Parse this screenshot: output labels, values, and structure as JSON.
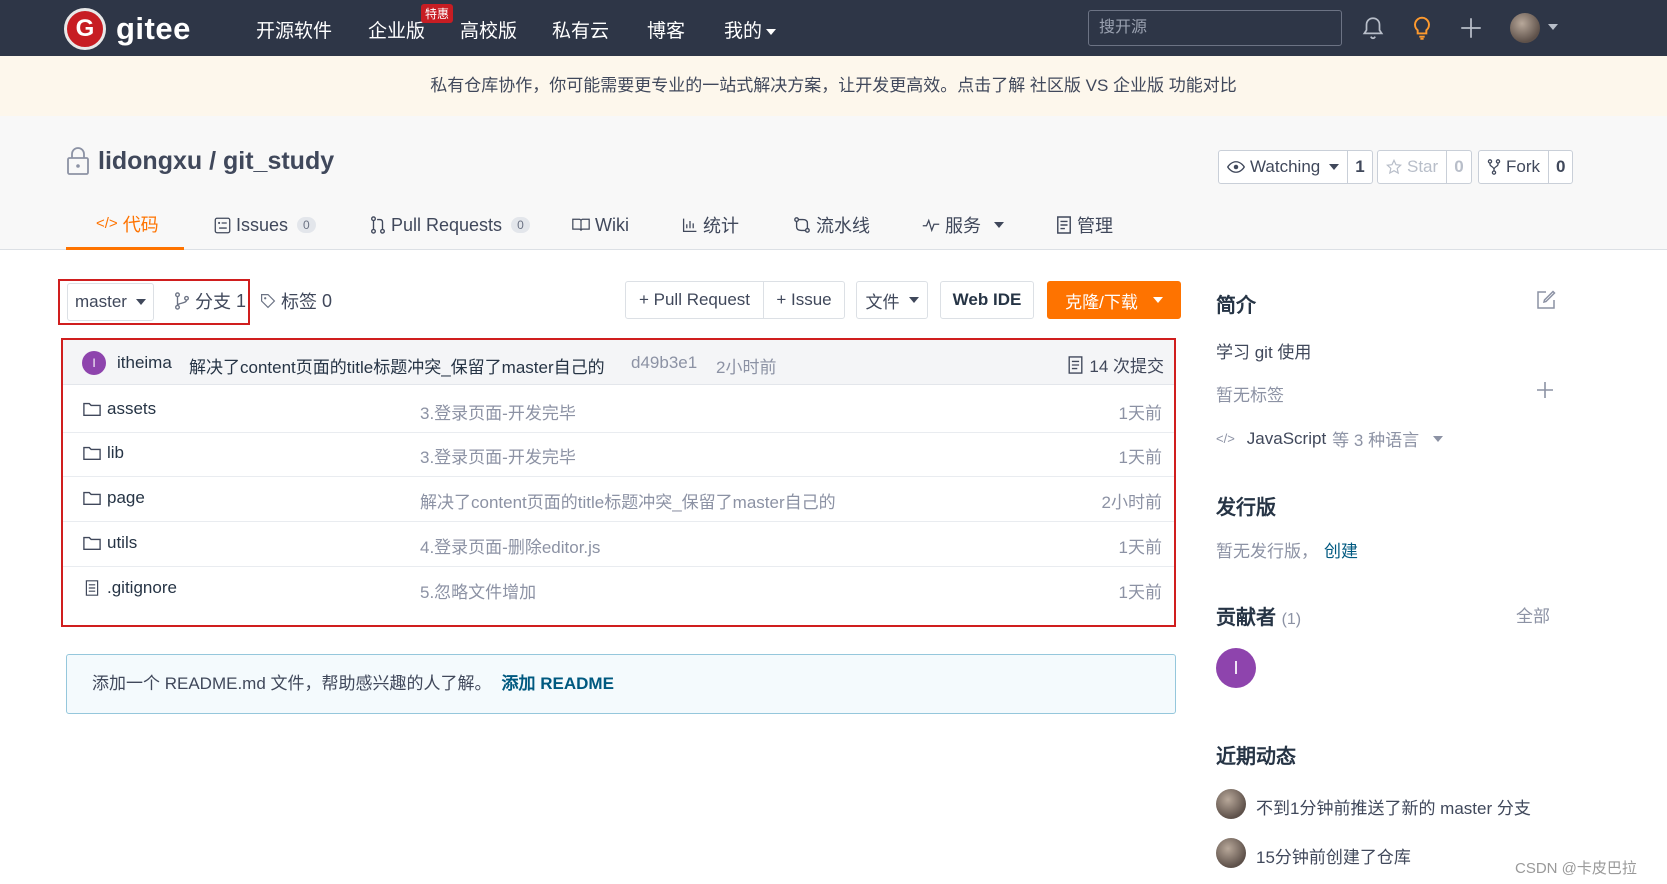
{
  "colors": {
    "nav_bg": "#2e3647",
    "accent": "#fe7300",
    "brand_red": "#c71d23",
    "highlight_box": "#d01e1e",
    "avatar_purple": "#8e44ad"
  },
  "topnav": {
    "logo_letter": "G",
    "logo_text": "gitee",
    "items": [
      "开源软件",
      "企业版",
      "高校版",
      "私有云",
      "博客",
      "我的"
    ],
    "badge": "特惠",
    "search_placeholder": "搜开源",
    "icons": [
      "bell-icon",
      "lightbulb-icon",
      "plus-icon",
      "user-avatar"
    ]
  },
  "banner": {
    "text": "私有仓库协作，你可能需要更专业的一站式解决方案，让开发更高效。点击了解 社区版 VS 企业版 功能对比"
  },
  "repo": {
    "owner": "lidongxu",
    "separator": " / ",
    "name": "git_study",
    "watch_label": "Watching",
    "watch_count": "1",
    "star_label": "Star",
    "star_count": "0",
    "fork_label": "Fork",
    "fork_count": "0"
  },
  "tabs": [
    {
      "label": "代码",
      "icon": "code-icon"
    },
    {
      "label": "Issues",
      "count": "0",
      "icon": "issues-icon"
    },
    {
      "label": "Pull Requests",
      "count": "0",
      "icon": "pull-request-icon"
    },
    {
      "label": "Wiki",
      "icon": "wiki-icon"
    },
    {
      "label": "统计",
      "icon": "stats-icon"
    },
    {
      "label": "流水线",
      "icon": "pipeline-icon"
    },
    {
      "label": "服务",
      "icon": "service-icon"
    },
    {
      "label": "管理",
      "icon": "manage-icon"
    }
  ],
  "branchbar": {
    "branch": "master",
    "branches_label": "分支",
    "branches_count": "1",
    "tags_label": "标签",
    "tags_count": "0",
    "pull_request_btn": "+ Pull Request",
    "issue_btn": "+ Issue",
    "file_btn": "文件",
    "webide_btn": "Web IDE",
    "clone_btn": "克隆/下载"
  },
  "commit": {
    "avatar_letter": "I",
    "author": "itheima",
    "message": "解决了content页面的title标题冲突_保留了master自己的",
    "hash": "d49b3e1",
    "time": "2小时前",
    "count_label": "14 次提交"
  },
  "files": [
    {
      "name": "assets",
      "type": "folder",
      "message": "3.登录页面-开发完毕",
      "time": "1天前"
    },
    {
      "name": "lib",
      "type": "folder",
      "message": "3.登录页面-开发完毕",
      "time": "1天前"
    },
    {
      "name": "page",
      "type": "folder",
      "message": "解决了content页面的title标题冲突_保留了master自己的",
      "time": "2小时前"
    },
    {
      "name": "utils",
      "type": "folder",
      "message": "4.登录页面-删除editor.js",
      "time": "1天前"
    },
    {
      "name": ".gitignore",
      "type": "file",
      "message": "5.忽略文件增加",
      "time": "1天前"
    }
  ],
  "readme": {
    "text": "添加一个 README.md 文件，帮助感兴趣的人了解。",
    "link": "添加 README"
  },
  "sidebar": {
    "intro_title": "简介",
    "intro_text": "学习 git 使用",
    "no_tags": "暂无标签",
    "language": "JavaScript",
    "language_more": "等 3 种语言",
    "release_title": "发行版",
    "release_text": "暂无发行版，",
    "release_link": "创建",
    "contrib_title": "贡献者",
    "contrib_count": "(1)",
    "contrib_all": "全部",
    "contrib_avatar_letter": "I",
    "activity_title": "近期动态",
    "activities": [
      "不到1分钟前推送了新的 master 分支",
      "15分钟前创建了仓库"
    ]
  },
  "watermark": "CSDN @卡皮巴拉"
}
